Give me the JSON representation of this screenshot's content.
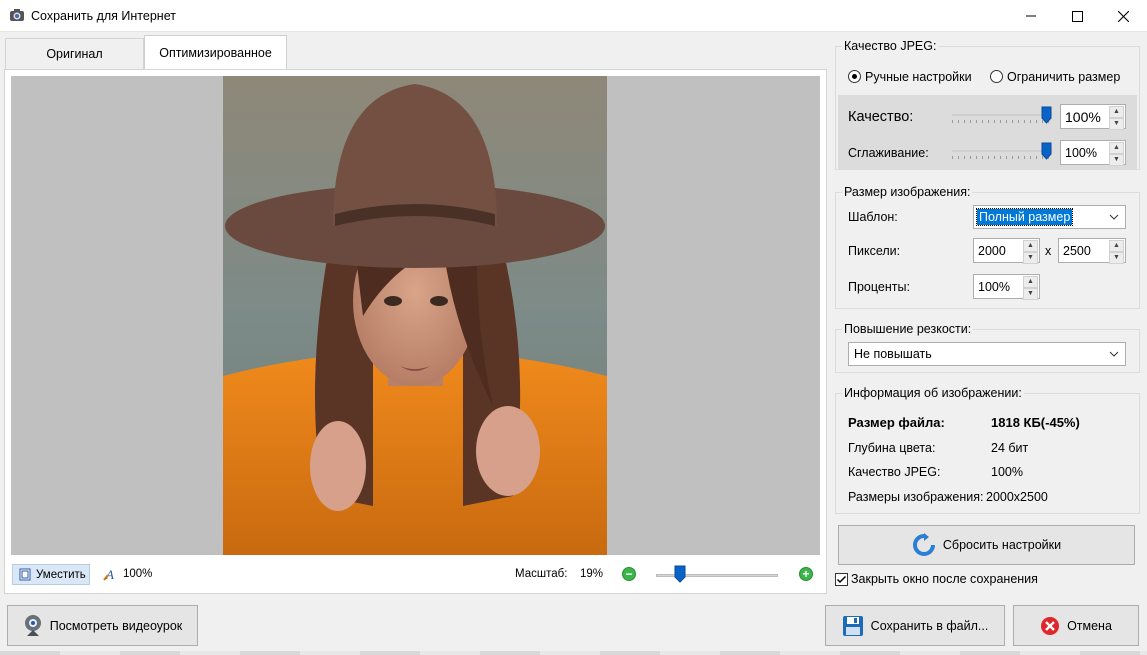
{
  "window": {
    "title": "Сохранить для Интернет"
  },
  "tabs": [
    {
      "label": "Оригинал"
    },
    {
      "label": "Оптимизированное"
    }
  ],
  "preview_bar": {
    "fit_label": "Уместить",
    "zoom_100_label": "100%",
    "scale_label": "Масштаб:",
    "scale_value": "19%",
    "scale_level": 0.19
  },
  "jpeg_quality": {
    "title": "Качество JPEG:",
    "mode_manual": "Ручные настройки",
    "mode_limit": "Ограничить размер",
    "quality_label": "Качество:",
    "quality_value": "100%",
    "quality_level": 1.0,
    "smoothing_label": "Сглаживание:",
    "smoothing_value": "100%",
    "smoothing_level": 1.0
  },
  "image_size": {
    "title": "Размер изображения:",
    "template_label": "Шаблон:",
    "template_value": "Полный размер",
    "pixels_label": "Пиксели:",
    "width": "2000",
    "times": "x",
    "height": "2500",
    "percent_label": "Проценты:",
    "percent_value": "100%"
  },
  "sharpen": {
    "title": "Повышение резкости:",
    "value": "Не повышать"
  },
  "info": {
    "title": "Информация об изображении:",
    "file_size_label": "Размер файла:",
    "file_size_value": "1818 КБ(-45%)",
    "depth_label": "Глубина цвета:",
    "depth_value": "24 бит",
    "jpeg_q_label": "Качество JPEG:",
    "jpeg_q_value": "100%",
    "dims_label": "Размеры изображения:",
    "dims_value": "2000x2500"
  },
  "buttons": {
    "reset": "Сбросить настройки",
    "close_after_save": "Закрыть окно после сохранения",
    "video": "Посмотреть видеоурок",
    "save": "Сохранить в файл...",
    "cancel": "Отмена"
  },
  "colors": {
    "accent": "#0a64c8",
    "selection": "#0078d7",
    "tab_active": "#ffffff",
    "canvas_bg": "#c0c0c0",
    "cancel_red": "#e0262b"
  },
  "icons": [
    "camera-icon",
    "minimize-icon",
    "maximize-icon",
    "close-icon",
    "fit-icon",
    "zoom-100-icon",
    "zoom-out-icon",
    "zoom-in-icon",
    "refresh-icon",
    "checkbox-icon",
    "webcam-icon",
    "floppy-icon",
    "cancel-icon",
    "chevron-down-icon"
  ]
}
